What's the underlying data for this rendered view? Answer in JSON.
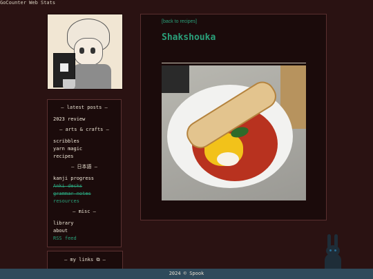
{
  "counter_alt": "GoCounter Web Stats",
  "sidebar": {
    "latest_heading": "— latest posts —",
    "latest_posts": [
      {
        "label": "2023 review",
        "style": "normal"
      }
    ],
    "sections": [
      {
        "heading": "— arts & crafts —",
        "items": [
          {
            "label": "scribbles",
            "style": "normal"
          },
          {
            "label": "yarn magic",
            "style": "normal"
          },
          {
            "label": "recipes",
            "style": "normal"
          }
        ]
      },
      {
        "heading": "— 日本語 —",
        "items": [
          {
            "label": "kanji progress",
            "style": "normal"
          },
          {
            "label": "Anki decks",
            "style": "teal-strike"
          },
          {
            "label": "grammar notes",
            "style": "teal-strike"
          },
          {
            "label": "resources",
            "style": "teal"
          }
        ]
      },
      {
        "heading": "— misc —",
        "items": [
          {
            "label": "library",
            "style": "normal"
          },
          {
            "label": "about",
            "style": "normal"
          },
          {
            "label": "RSS feed",
            "style": "teal"
          }
        ]
      }
    ],
    "links_heading": "— my links ⧉ —"
  },
  "main": {
    "back_link": "[back to recipes]",
    "title": "Shakshouka"
  },
  "footer": {
    "text": "2024 © Spook"
  },
  "colors": {
    "accent": "#2aa07a",
    "background": "#2a1212",
    "panel": "#1b0b0b",
    "footer": "#2f4a5b"
  }
}
